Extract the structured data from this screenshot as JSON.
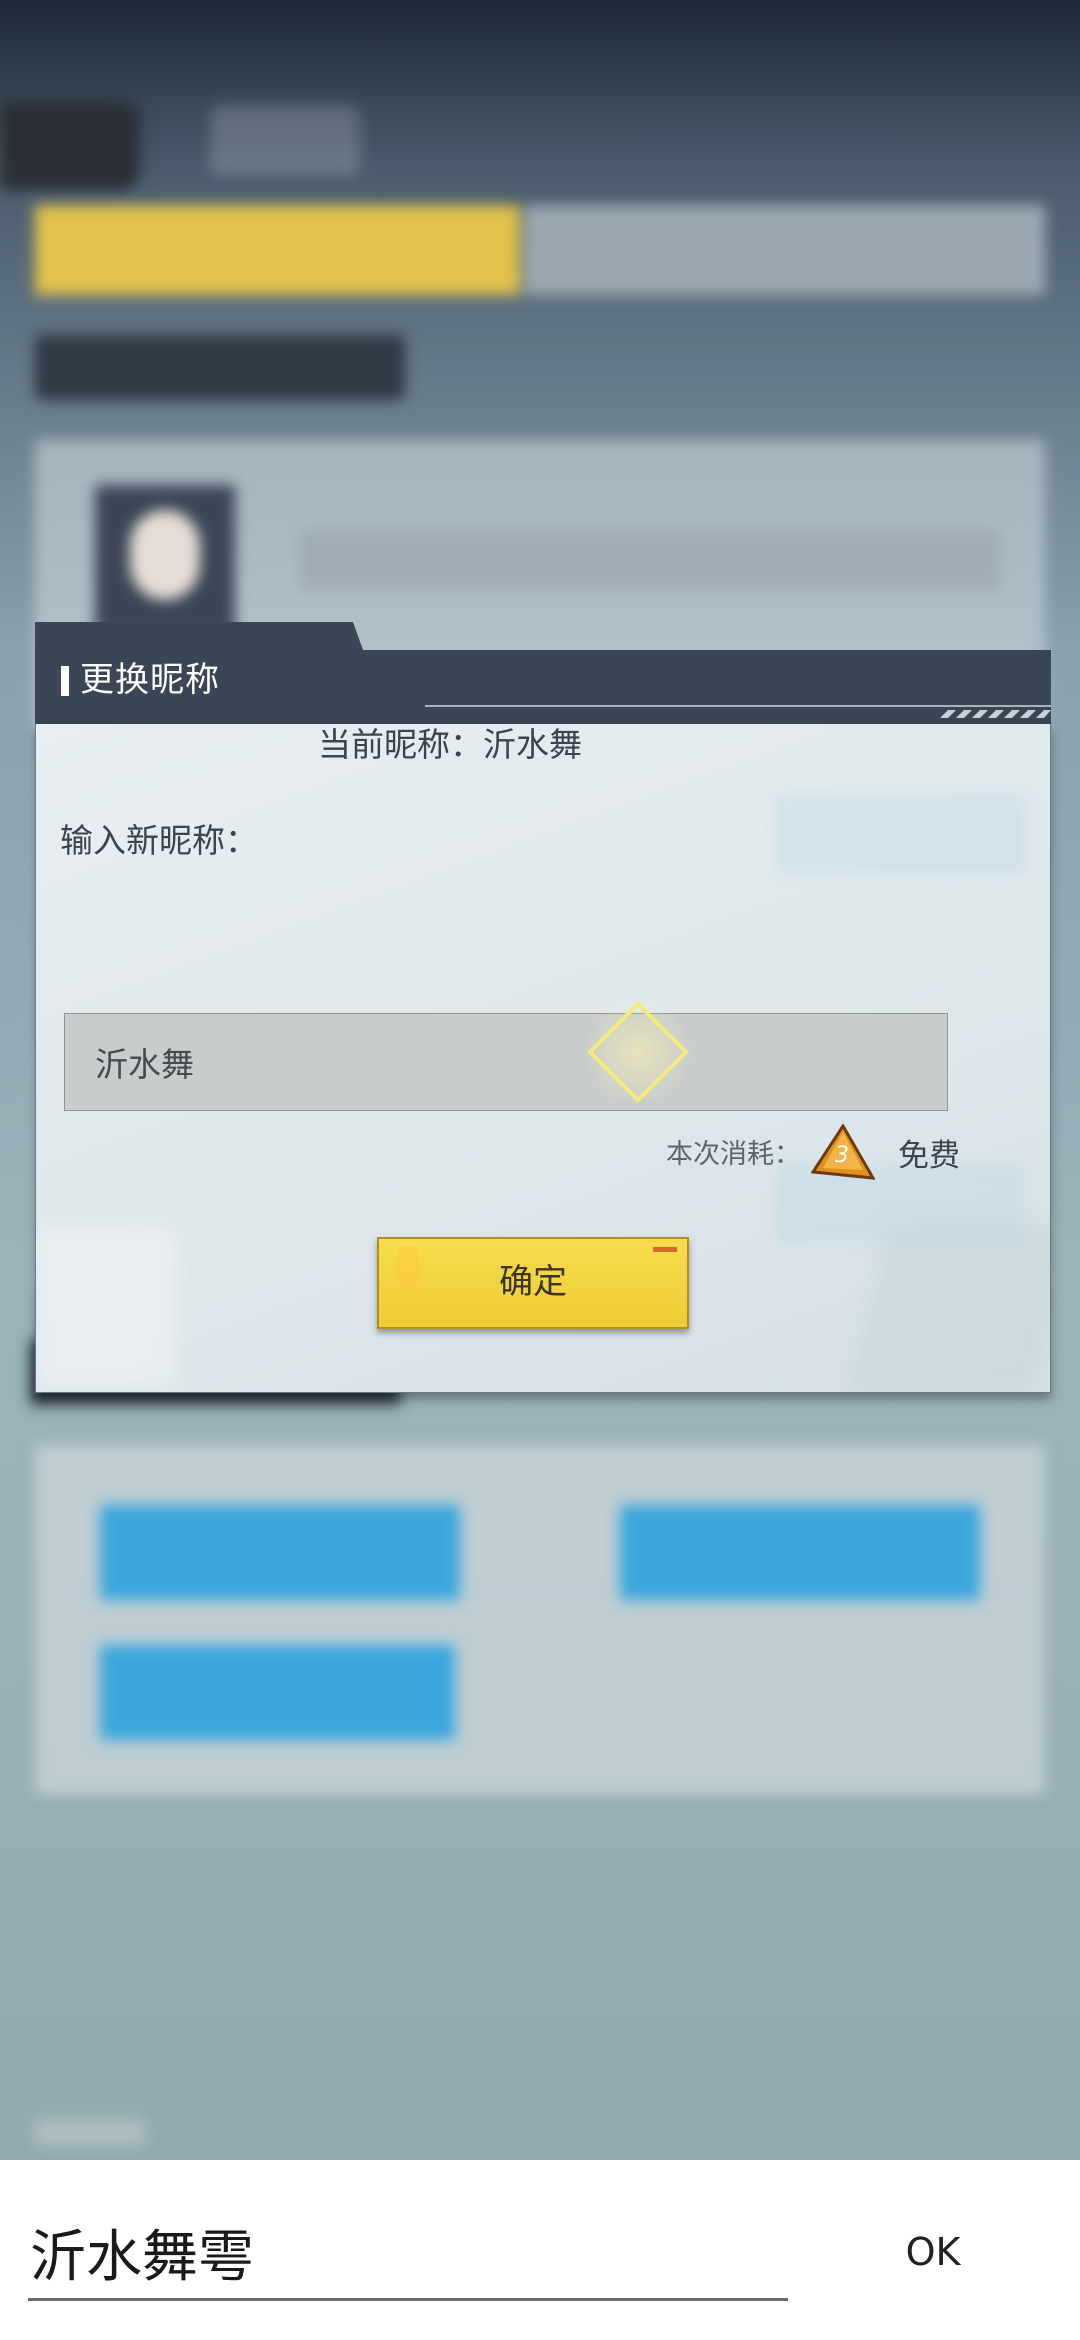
{
  "dialog": {
    "title": "更换昵称",
    "current_nickname": "当前昵称：沂水舞",
    "input_label": "输入新昵称：",
    "input_value": "沂水舞",
    "cost_label": "本次消耗：",
    "cost_value": "免费",
    "confirm_label": "确定"
  },
  "ime": {
    "composing_text": "沂水舞雩",
    "ok_label": "OK"
  },
  "colors": {
    "header_dark": "#3a4656",
    "confirm_yellow": "#f2d23f",
    "token_orange": "#e0901f"
  },
  "icons": [
    "diamond-icon",
    "token-icon"
  ]
}
